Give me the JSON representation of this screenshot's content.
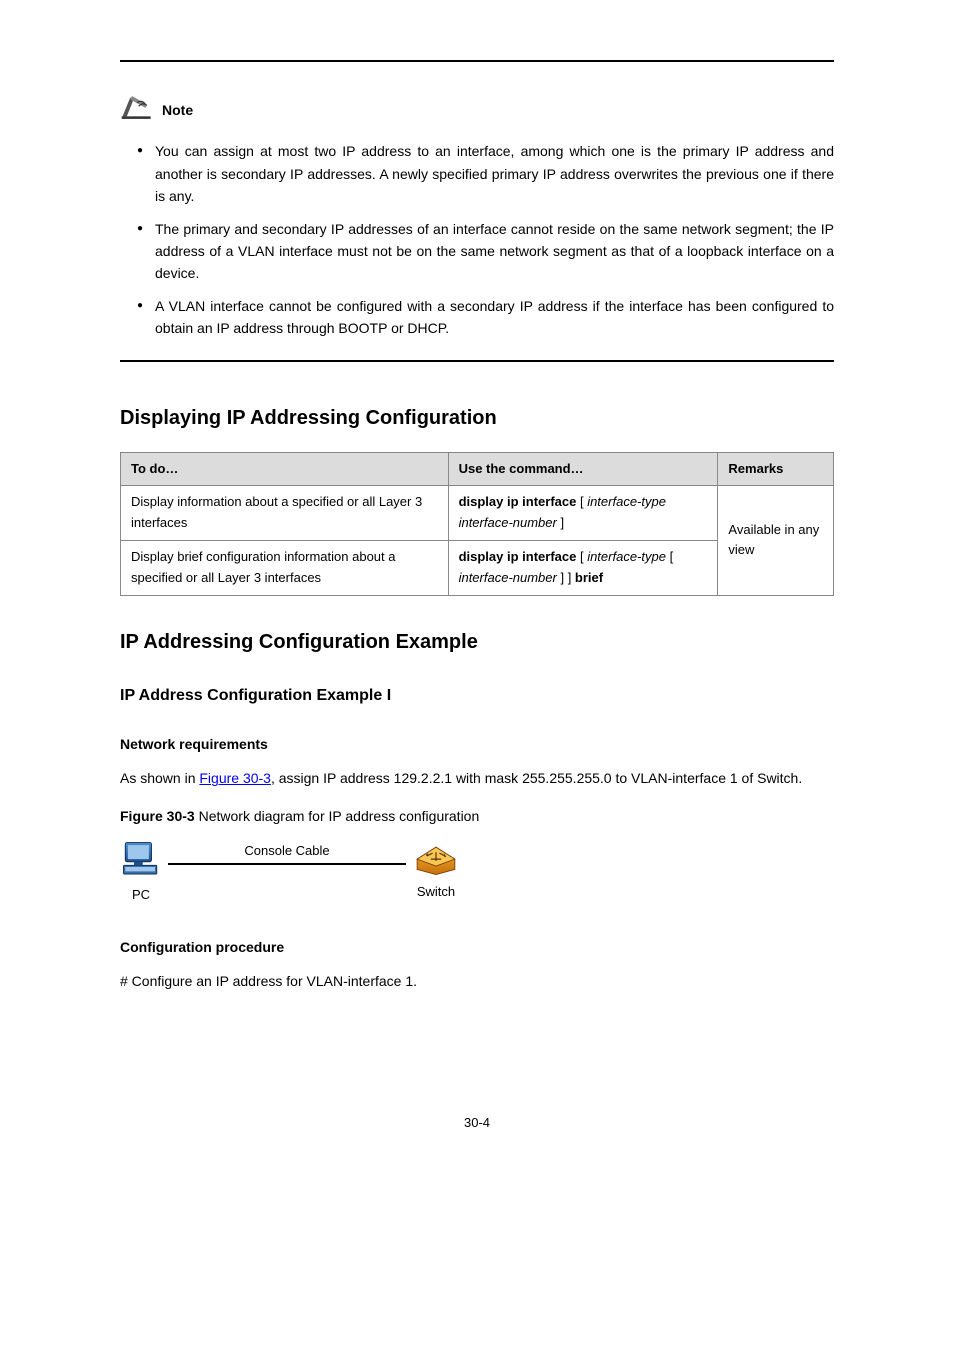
{
  "note": {
    "title": "Note",
    "bullets": [
      "You can assign at most two IP address to an interface, among which one is the primary IP address and another is secondary IP addresses. A newly specified primary IP address overwrites the previous one if there is any.",
      "The primary and secondary IP addresses of an interface cannot reside on the same network segment; the IP address of a VLAN interface must not be on the same network segment as that of a loopback interface on a device.",
      "A VLAN interface cannot be configured with a secondary IP address if the interface has been configured to obtain an IP address through BOOTP or DHCP."
    ]
  },
  "display_section": {
    "heading": "Displaying IP Addressing Configuration",
    "table": {
      "headers": [
        "To do…",
        "Use the command…",
        "Remarks"
      ],
      "rows": [
        {
          "todo": "Display information about a specified or all Layer 3 interfaces",
          "cmd": "display ip interface [ interface-type interface-number ]"
        },
        {
          "todo": "Display brief configuration information about a specified or all Layer 3 interfaces",
          "cmd": "display ip interface [ interface-type [ interface-number ] ] brief"
        }
      ],
      "remarks": "Available in any view"
    }
  },
  "example_section": {
    "heading": "IP Addressing Configuration Example",
    "sub1": "IP Address Configuration Example I",
    "net_req_heading": "Network requirements",
    "net_req_text_prefix": "As shown in ",
    "net_req_link": "Figure 30-3",
    "net_req_text_suffix": ", assign IP address 129.2.2.1 with mask 255.255.255.0 to VLAN-interface 1 of Switch.",
    "figure_caption_prefix": "Figure 30-3",
    "figure_caption_rest": " Network diagram for IP address configuration",
    "cable_label": "Console Cable",
    "pc_label": "PC",
    "switch_label": "Switch",
    "config_proc_heading": "Configuration procedure",
    "config_step": "# Configure an IP address for VLAN-interface 1."
  },
  "page_number": "30-4"
}
